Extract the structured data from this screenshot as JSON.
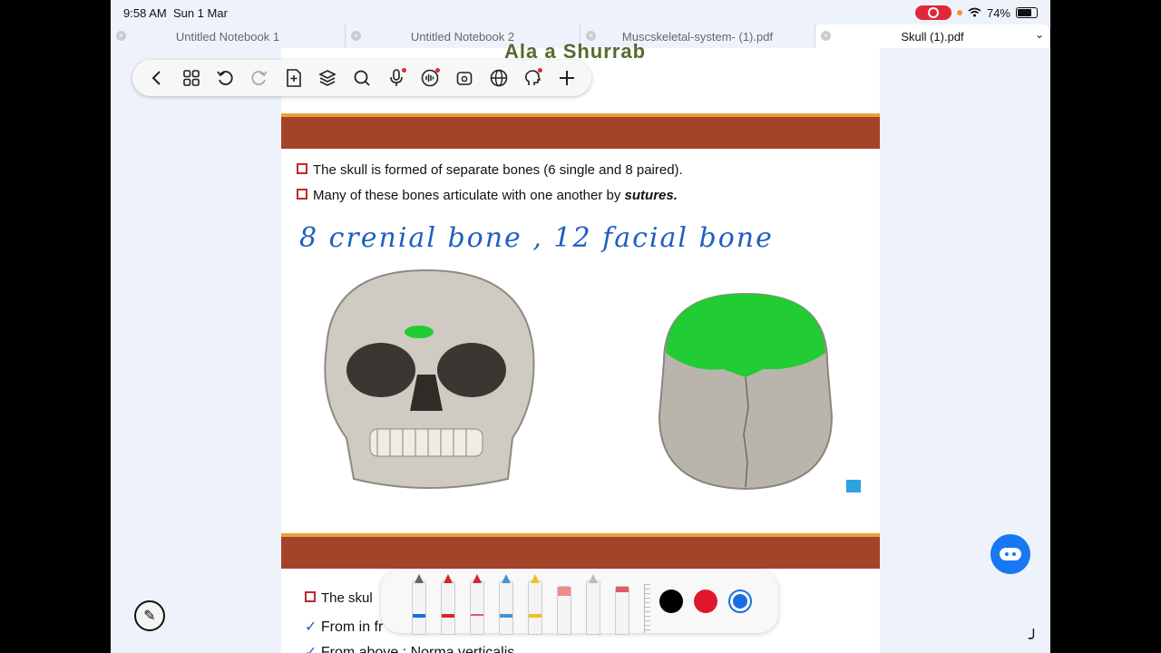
{
  "status": {
    "time": "9:58 AM",
    "date": "Sun 1 Mar",
    "battery": "74%"
  },
  "tabs": [
    {
      "label": "Untitled Notebook 1",
      "active": false
    },
    {
      "label": "Untitled Notebook 2",
      "active": false
    },
    {
      "label": "Muscskeletal-system- (1).pdf",
      "active": false
    },
    {
      "label": "Skull (1).pdf",
      "active": true
    }
  ],
  "doc": {
    "title_fragment": "Ala a Shurrab",
    "bullet1": "The skull is formed of separate bones (6 single and 8 paired).",
    "bullet2_pre": "Many of these bones articulate with one another by ",
    "bullet2_em": "sutures.",
    "handwriting": "8 crenial bone   , 12 facial bone",
    "bottom1": "The skul",
    "bottom2": "From in fr",
    "bottom3": "From above : Norma verticalis"
  },
  "toolbar_icons": [
    "back-icon",
    "grid-icon",
    "undo-icon",
    "redo-icon",
    "add-page-icon",
    "layers-icon",
    "search-icon",
    "mic-icon",
    "audio-icon",
    "clip-icon",
    "globe-icon",
    "ai-assist-icon",
    "plus-icon"
  ],
  "colors": {
    "accent_band": "#a3442a",
    "highlight_green": "#22cc33",
    "ink_blue": "#1f5fbf",
    "swatch_black": "#000000",
    "swatch_red": "#e0172c",
    "swatch_blue": "#1a6fe0"
  }
}
